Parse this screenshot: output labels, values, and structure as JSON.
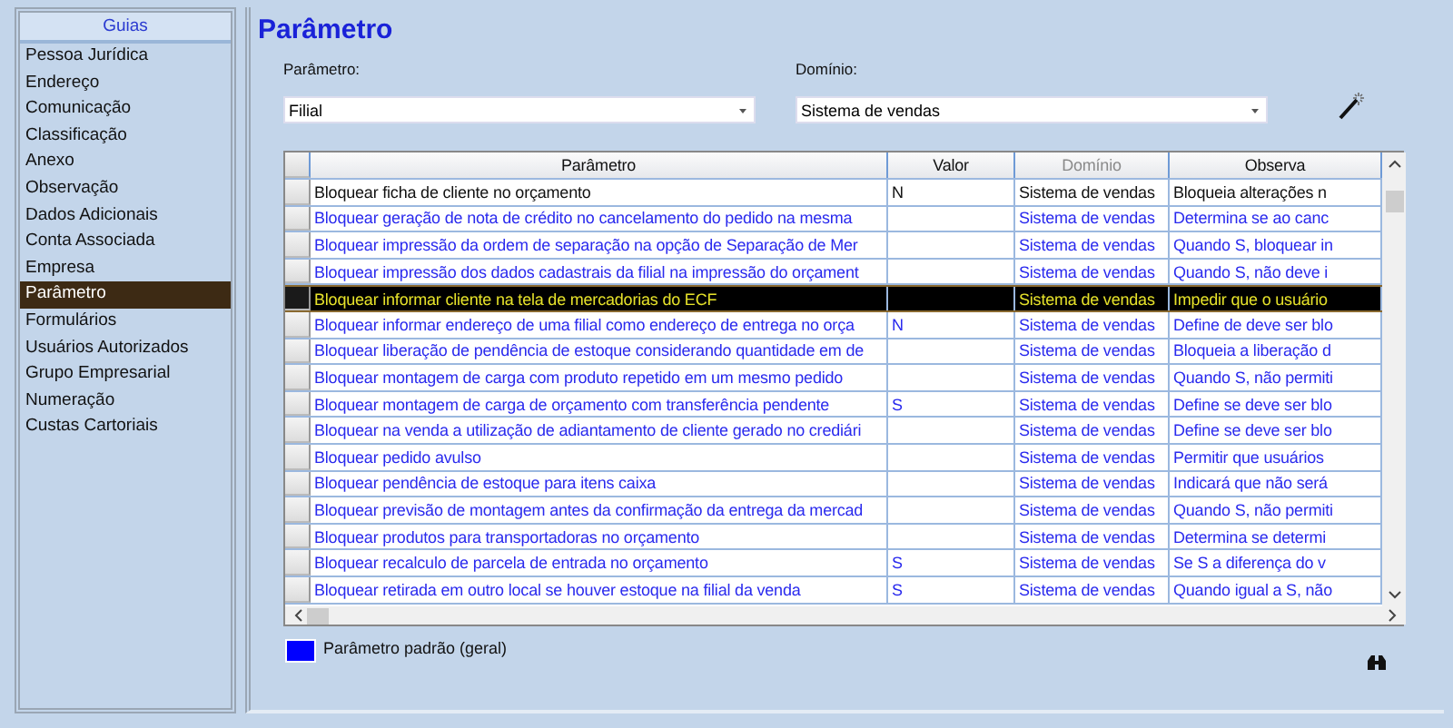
{
  "sidebar": {
    "title": "Guias",
    "items": [
      {
        "label": "Pessoa Jurídica",
        "selected": false
      },
      {
        "label": "Endereço",
        "selected": false
      },
      {
        "label": "Comunicação",
        "selected": false
      },
      {
        "label": "Classificação",
        "selected": false
      },
      {
        "label": "Anexo",
        "selected": false
      },
      {
        "label": "Observação",
        "selected": false
      },
      {
        "label": "Dados Adicionais",
        "selected": false
      },
      {
        "label": "Conta Associada",
        "selected": false
      },
      {
        "label": "Empresa",
        "selected": false
      },
      {
        "label": "Parâmetro",
        "selected": true
      },
      {
        "label": "Formulários",
        "selected": false
      },
      {
        "label": "Usuários Autorizados",
        "selected": false
      },
      {
        "label": "Grupo Empresarial",
        "selected": false
      },
      {
        "label": "Numeração",
        "selected": false
      },
      {
        "label": "Custas Cartoriais",
        "selected": false
      }
    ]
  },
  "title": "Parâmetro",
  "filters": [
    {
      "label": "Parâmetro:",
      "value": "Filial"
    },
    {
      "label": "Domínio:",
      "value": "Sistema de vendas"
    }
  ],
  "table": {
    "columns": [
      {
        "label": "Parâmetro",
        "disabled": false
      },
      {
        "label": "Valor",
        "disabled": false
      },
      {
        "label": "Domínio",
        "disabled": true
      },
      {
        "label": "Observa",
        "disabled": false
      }
    ],
    "rows": [
      {
        "cells": [
          "Bloquear ficha de cliente no orçamento",
          "N",
          "Sistema de vendas",
          "Bloqueia alterações n"
        ],
        "default": false,
        "selected": false
      },
      {
        "cells": [
          "Bloquear geração de nota de crédito no cancelamento do pedido na mesma",
          "",
          "Sistema de vendas",
          "Determina se ao canc"
        ],
        "default": true,
        "selected": false
      },
      {
        "cells": [
          "Bloquear impressão da ordem de separação na opção de Separação de Mer",
          "",
          "Sistema de vendas",
          "Quando S, bloquear in"
        ],
        "default": true,
        "selected": false
      },
      {
        "cells": [
          "Bloquear impressão dos dados cadastrais da filial na impressão do orçament",
          "",
          "Sistema de vendas",
          "Quando S, não deve i"
        ],
        "default": true,
        "selected": false
      },
      {
        "cells": [
          "Bloquear informar cliente na tela de mercadorias do ECF",
          "",
          "Sistema de vendas",
          "Impedir que o usuário"
        ],
        "default": true,
        "selected": true
      },
      {
        "cells": [
          "Bloquear informar endereço de uma filial como endereço de entrega no orça",
          "N",
          "Sistema de vendas",
          "Define de deve ser blo"
        ],
        "default": true,
        "selected": false
      },
      {
        "cells": [
          "Bloquear liberação de pendência de estoque considerando quantidade em de",
          "",
          "Sistema de vendas",
          "Bloqueia a liberação d"
        ],
        "default": true,
        "selected": false
      },
      {
        "cells": [
          "Bloquear montagem de carga com produto repetido em um mesmo pedido",
          "",
          "Sistema de vendas",
          "Quando S, não permiti"
        ],
        "default": true,
        "selected": false
      },
      {
        "cells": [
          "Bloquear montagem de carga de orçamento com transferência pendente",
          "S",
          "Sistema de vendas",
          "Define se deve ser blo"
        ],
        "default": true,
        "selected": false
      },
      {
        "cells": [
          "Bloquear na venda a utilização de adiantamento de cliente gerado no crediári",
          "",
          "Sistema de vendas",
          "Define se deve ser blo"
        ],
        "default": true,
        "selected": false
      },
      {
        "cells": [
          "Bloquear pedido avulso",
          "",
          "Sistema de vendas",
          "Permitir que usuários"
        ],
        "default": true,
        "selected": false
      },
      {
        "cells": [
          "Bloquear pendência de estoque para itens caixa",
          "",
          "Sistema de vendas",
          "Indicará que não será"
        ],
        "default": true,
        "selected": false
      },
      {
        "cells": [
          "Bloquear previsão de montagem antes da confirmação da entrega da mercad",
          "",
          "Sistema de vendas",
          "Quando S, não permiti"
        ],
        "default": true,
        "selected": false
      },
      {
        "cells": [
          "Bloquear produtos para transportadoras no orçamento",
          "",
          "Sistema de vendas",
          "Determina  se determi"
        ],
        "default": true,
        "selected": false
      },
      {
        "cells": [
          "Bloquear recalculo de parcela de entrada no orçamento",
          "S",
          "Sistema de vendas",
          "Se S a diferença do v"
        ],
        "default": true,
        "selected": false
      },
      {
        "cells": [
          "Bloquear retirada em outro local se houver estoque na filial da venda",
          "S",
          "Sistema de vendas",
          "Quando igual a S, não"
        ],
        "default": true,
        "selected": false
      }
    ]
  },
  "legend": {
    "label": "Parâmetro padrão (geral)",
    "color": "#0000ff"
  }
}
